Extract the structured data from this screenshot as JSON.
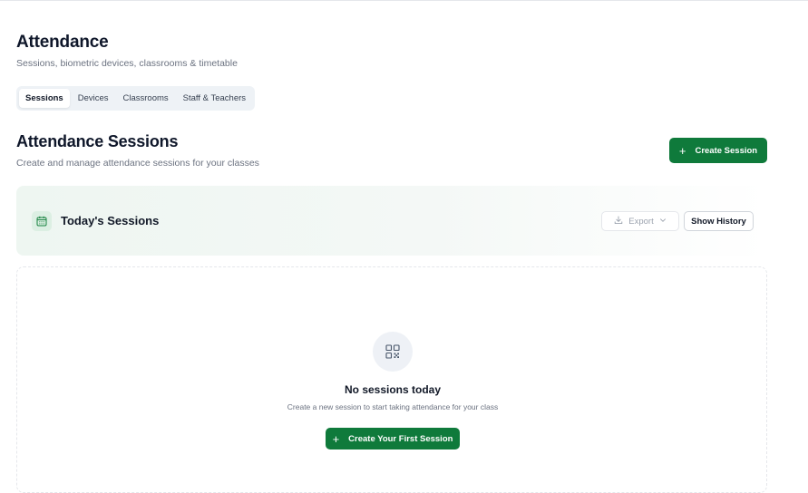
{
  "header": {
    "title": "Attendance",
    "subtitle": "Sessions, biometric devices, classrooms & timetable"
  },
  "tabs": [
    {
      "label": "Sessions",
      "active": true
    },
    {
      "label": "Devices",
      "active": false
    },
    {
      "label": "Classrooms",
      "active": false
    },
    {
      "label": "Staff & Teachers",
      "active": false
    }
  ],
  "section": {
    "title": "Attendance Sessions",
    "subtitle": "Create and manage attendance sessions for your classes",
    "create_button": "Create Session"
  },
  "today": {
    "title": "Today's Sessions",
    "export_label": "Export",
    "history_label": "Show History"
  },
  "empty_state": {
    "title": "No sessions today",
    "description": "Create a new session to start taking attendance for your class",
    "button": "Create Your First Session"
  },
  "colors": {
    "primary": "#0f7a3b",
    "panel_bg": "#eef6f1",
    "muted_text": "#6b7280"
  },
  "icons": {
    "calendar": "calendar-icon",
    "export": "download-icon",
    "chevron": "chevron-down-icon",
    "empty": "qr-code-icon",
    "plus": "plus-icon"
  }
}
